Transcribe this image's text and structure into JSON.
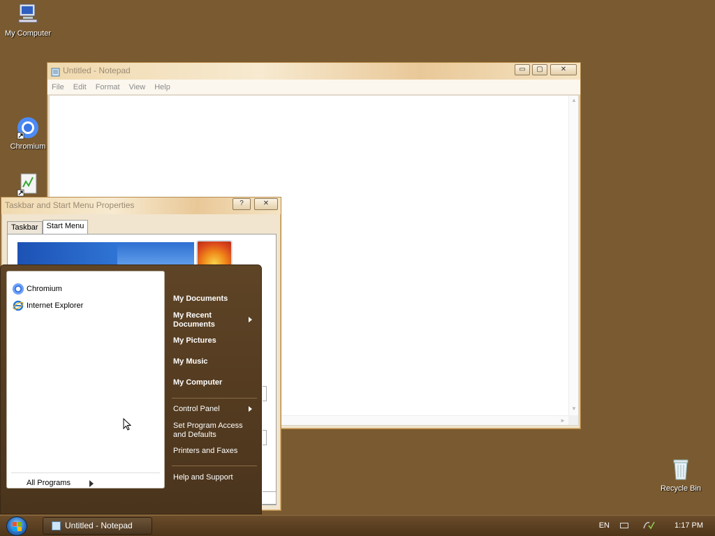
{
  "desktop": {
    "icons": [
      {
        "label": "My Computer"
      },
      {
        "label": "Chromium"
      },
      {
        "label": ""
      },
      {
        "label": "Recycle Bin"
      }
    ]
  },
  "notepad": {
    "title": "Untitled - Notepad",
    "menu": [
      "File",
      "Edit",
      "Format",
      "View",
      "Help"
    ],
    "buttons": {
      "minimize": "▭",
      "maximize": "▢",
      "close": "✕"
    }
  },
  "properties_dialog": {
    "title": "Taskbar and Start Menu Properties",
    "help_button": "?",
    "close_button": "✕",
    "tabs": [
      {
        "label": "Taskbar",
        "active": false
      },
      {
        "label": "Start Menu",
        "active": true
      }
    ]
  },
  "start_menu": {
    "pinned": [
      {
        "label": "Chromium",
        "icon": "chromium-icon"
      },
      {
        "label": "Internet Explorer",
        "icon": "ie-icon"
      }
    ],
    "all_programs": "All Programs",
    "right": [
      {
        "label": "My Documents",
        "bold": true,
        "arrow": false
      },
      {
        "label": "My Recent Documents",
        "bold": true,
        "arrow": true
      },
      {
        "label": "My Pictures",
        "bold": true,
        "arrow": false
      },
      {
        "label": "My Music",
        "bold": true,
        "arrow": false
      },
      {
        "label": "My Computer",
        "bold": true,
        "arrow": false
      },
      {
        "label": "Control Panel",
        "bold": false,
        "arrow": true
      },
      {
        "label": "Set Program Access and Defaults",
        "bold": false,
        "arrow": false
      },
      {
        "label": "Printers and Faxes",
        "bold": false,
        "arrow": false
      },
      {
        "label": "Help and Support",
        "bold": false,
        "arrow": false
      }
    ]
  },
  "taskbar": {
    "task_label": "Untitled - Notepad",
    "language": "EN",
    "clock": "1:17 PM"
  },
  "colors": {
    "desktop": "#7a5a30",
    "start_menu": "#5f4426",
    "taskbar": "#5a3f22"
  }
}
